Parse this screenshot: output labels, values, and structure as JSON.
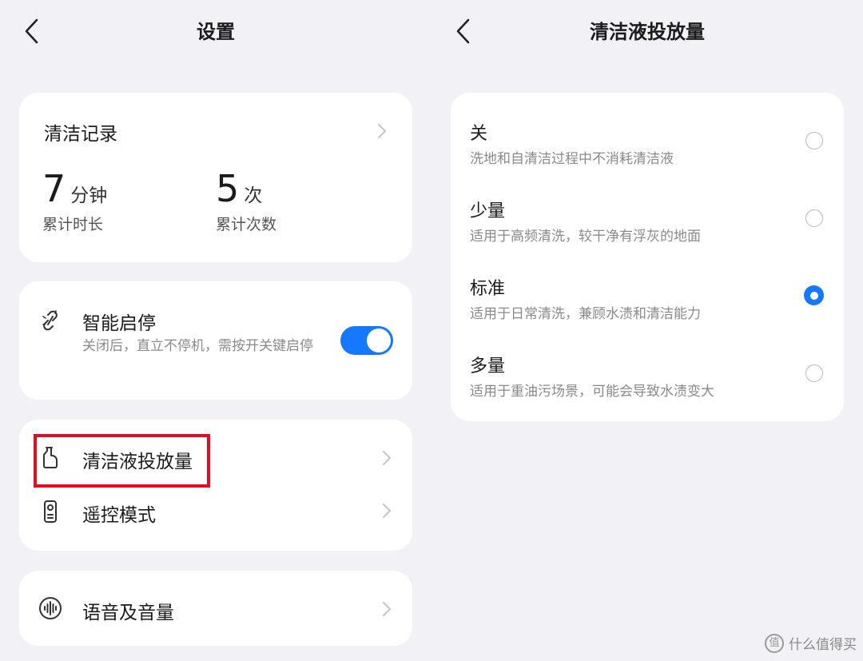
{
  "left": {
    "title": "设置",
    "record": {
      "title": "清洁记录",
      "duration_value": "7",
      "duration_unit": "分钟",
      "duration_label": "累计时长",
      "count_value": "5",
      "count_unit": "次",
      "count_label": "累计次数"
    },
    "smart": {
      "title": "智能启停",
      "subtitle": "关闭后，直立不停机，需按开关键启停",
      "enabled": true,
      "icon": "link-break-icon"
    },
    "menu": [
      {
        "label": "清洁液投放量",
        "icon": "bottle-icon"
      },
      {
        "label": "遥控模式",
        "icon": "remote-icon"
      }
    ],
    "voice": {
      "label": "语音及音量",
      "icon": "sound-wave-icon"
    }
  },
  "right": {
    "title": "清洁液投放量",
    "options": [
      {
        "label": "关",
        "desc": "洗地和自清洁过程中不消耗清洁液",
        "selected": false
      },
      {
        "label": "少量",
        "desc": "适用于高频清洗，较干净有浮灰的地面",
        "selected": false
      },
      {
        "label": "标准",
        "desc": "适用于日常清洗，兼顾水渍和清洁能力",
        "selected": true
      },
      {
        "label": "多量",
        "desc": "适用于重油污场景，可能会导致水渍变大",
        "selected": false
      }
    ]
  },
  "watermark": {
    "text": "什么值得买",
    "logo": "值"
  },
  "colors": {
    "accent": "#1677ff",
    "highlight": "#e20e1d",
    "background": "#f1f1f6"
  }
}
